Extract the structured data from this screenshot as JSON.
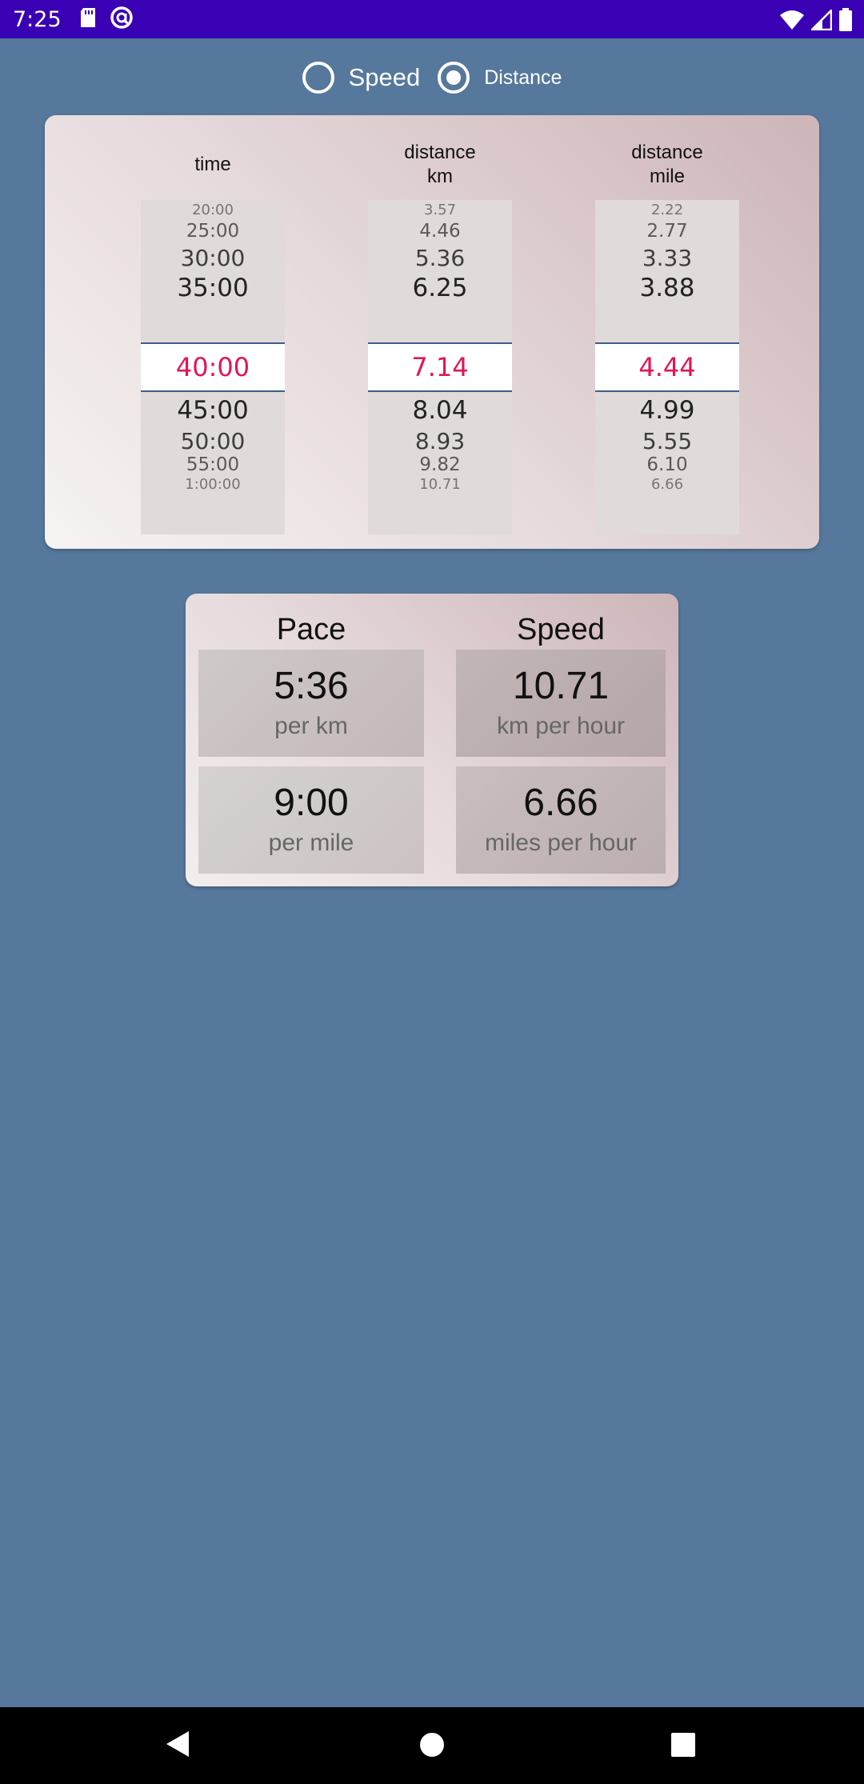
{
  "status_bar": {
    "time": "7:25",
    "left_icons": [
      "sd-card-icon",
      "at-sign-icon"
    ],
    "right_icons": [
      "wifi-icon",
      "signal-icon",
      "battery-icon"
    ]
  },
  "mode_selector": {
    "options": [
      {
        "label": "Speed",
        "checked": false
      },
      {
        "label": "Distance",
        "checked": true
      }
    ]
  },
  "picker": {
    "columns": [
      {
        "header": "time",
        "above": [
          "20:00",
          "25:00",
          "30:00",
          "35:00"
        ],
        "selected": "40:00",
        "below": [
          "45:00",
          "50:00",
          "55:00",
          "1:00:00"
        ]
      },
      {
        "header": "distance\nkm",
        "above": [
          "3.57",
          "4.46",
          "5.36",
          "6.25"
        ],
        "selected": "7.14",
        "below": [
          "8.04",
          "8.93",
          "9.82",
          "10.71"
        ]
      },
      {
        "header": "distance\nmile",
        "above": [
          "2.22",
          "2.77",
          "3.33",
          "3.88"
        ],
        "selected": "4.44",
        "below": [
          "4.99",
          "5.55",
          "6.10",
          "6.66"
        ]
      }
    ]
  },
  "results": {
    "pace_heading": "Pace",
    "speed_heading": "Speed",
    "pace_km": {
      "value": "5:36",
      "unit": "per km"
    },
    "pace_mile": {
      "value": "9:00",
      "unit": "per mile"
    },
    "speed_km": {
      "value": "10.71",
      "unit": "km per hour"
    },
    "speed_mile": {
      "value": "6.66",
      "unit": "miles per hour"
    }
  },
  "colors": {
    "background": "#56789c",
    "status_bar": "#3a00b4",
    "selected_text": "#e0155a",
    "selection_line": "#3f5e88"
  },
  "nav_bar": {
    "buttons": [
      "back-icon",
      "home-icon",
      "recents-icon"
    ]
  }
}
